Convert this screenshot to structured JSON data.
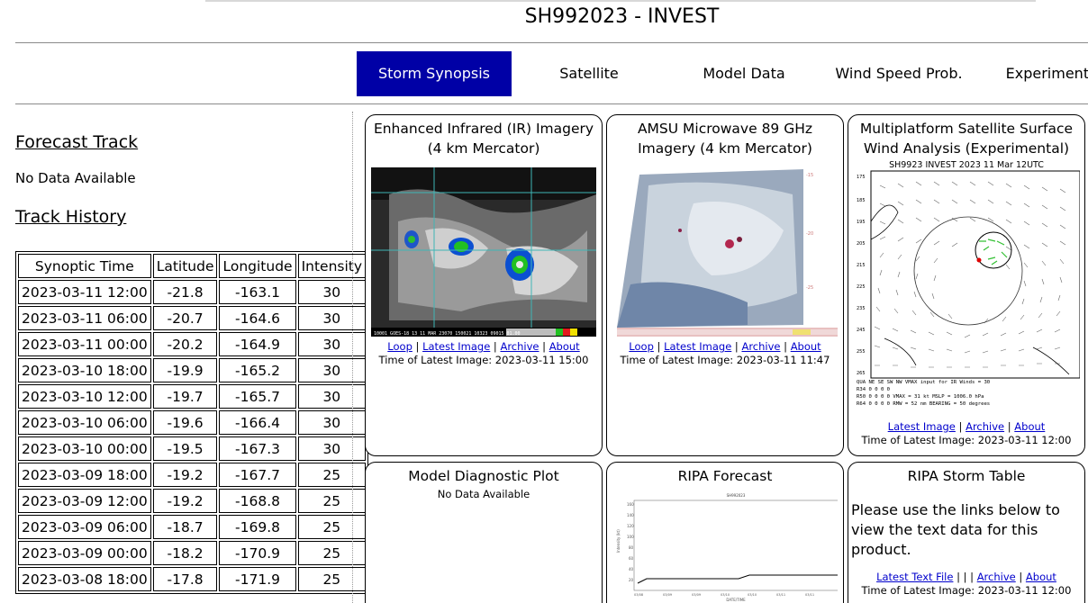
{
  "page_title": "SH992023 - INVEST",
  "tabs": [
    "Storm Synopsis",
    "Satellite",
    "Model Data",
    "Wind Speed Prob.",
    "Experimental"
  ],
  "forecast_track": {
    "title": "Forecast Track",
    "status": "No Data Available"
  },
  "track_history": {
    "title": "Track History",
    "columns": [
      "Synoptic Time",
      "Latitude",
      "Longitude",
      "Intensity"
    ],
    "rows": [
      [
        "2023-03-11 12:00",
        "-21.8",
        "-163.1",
        "30"
      ],
      [
        "2023-03-11 06:00",
        "-20.7",
        "-164.6",
        "30"
      ],
      [
        "2023-03-11 00:00",
        "-20.2",
        "-164.9",
        "30"
      ],
      [
        "2023-03-10 18:00",
        "-19.9",
        "-165.2",
        "30"
      ],
      [
        "2023-03-10 12:00",
        "-19.7",
        "-165.7",
        "30"
      ],
      [
        "2023-03-10 06:00",
        "-19.6",
        "-166.4",
        "30"
      ],
      [
        "2023-03-10 00:00",
        "-19.5",
        "-167.3",
        "30"
      ],
      [
        "2023-03-09 18:00",
        "-19.2",
        "-167.7",
        "25"
      ],
      [
        "2023-03-09 12:00",
        "-19.2",
        "-168.8",
        "25"
      ],
      [
        "2023-03-09 06:00",
        "-18.7",
        "-169.8",
        "25"
      ],
      [
        "2023-03-09 00:00",
        "-18.2",
        "-170.9",
        "25"
      ],
      [
        "2023-03-08 18:00",
        "-17.8",
        "-171.9",
        "25"
      ]
    ]
  },
  "panels": {
    "ir": {
      "title": "Enhanced Infrared (IR) Imagery (4 km Mercator)",
      "links": [
        "Loop",
        "Latest Image",
        "Archive",
        "About"
      ],
      "latest": "Time of Latest Image: 2023-03-11 15:00",
      "caption": "10001 GOES-18   13 11 MAR 23070 150021 10323 09015 01.00"
    },
    "amsu": {
      "title": "AMSU Microwave 89 GHz Imagery (4 km Mercator)",
      "links": [
        "Loop",
        "Latest Image",
        "Archive",
        "About"
      ],
      "latest": "Time of Latest Image: 2023-03-11 11:47"
    },
    "wind": {
      "title": "Multiplatform Satellite Surface Wind Analysis (Experimental)",
      "header": "SH9923    INVEST    2023  11  Mar  12UTC",
      "footer_lines": [
        "QUA  NE  SE  SW  NW   VMAX input for IR Winds =  30",
        "R34   0   0   0   0",
        "R50   0   0   0   0   VMAX =  31 kt  MSLP = 1006.0 hPa",
        "R64   0   0   0   0   RMW  =  52 nm  BEARING =  50 degrees"
      ],
      "links": [
        "Latest Image",
        "Archive",
        "About"
      ],
      "latest": "Time of Latest Image: 2023-03-11 12:00"
    },
    "model_diag": {
      "title": "Model Diagnostic Plot",
      "status": "No Data Available"
    },
    "ripa_forecast": {
      "title": "RIPA Forecast",
      "chart_title": "SH992023",
      "xlabel": "DATE/TIME",
      "ylabel": "Intensity (kt)"
    },
    "ripa_table": {
      "title": "RIPA Storm Table",
      "text": "Please use the links below to view the text data for this product.",
      "links": [
        "Latest Text File",
        "|",
        "Archive",
        "About"
      ],
      "latest": "Time of Latest Image: 2023-03-11 12:00"
    }
  },
  "colors": {
    "active_tab": "#0000a6",
    "link": "#0000cc"
  }
}
